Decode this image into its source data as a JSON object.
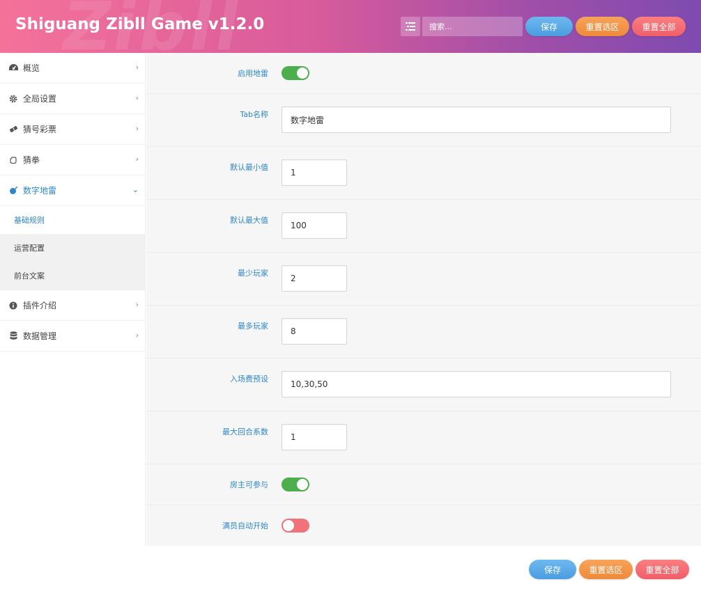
{
  "header": {
    "title": "Shiguang Zibll Game v1.2.0",
    "search_placeholder": "搜索...",
    "save_label": "保存",
    "reset_section_label": "重置选区",
    "reset_all_label": "重置全部"
  },
  "sidebar": {
    "items": [
      {
        "label": "概览",
        "icon": "dashboard-icon"
      },
      {
        "label": "全局设置",
        "icon": "gear-icon"
      },
      {
        "label": "猜号彩票",
        "icon": "ticket-icon"
      },
      {
        "label": "猜拳",
        "icon": "hand-icon"
      },
      {
        "label": "数字地雷",
        "icon": "bomb-icon",
        "active": true
      },
      {
        "label": "插件介绍",
        "icon": "info-icon"
      },
      {
        "label": "数据管理",
        "icon": "database-icon"
      }
    ],
    "subitems": [
      {
        "label": "基础规则",
        "active": true
      },
      {
        "label": "运营配置"
      },
      {
        "label": "前台文案"
      }
    ]
  },
  "form": {
    "enable_mines_label": "启用地雷",
    "enable_mines_on": true,
    "tab_name_label": "Tab名称",
    "tab_name_value": "数字地雷",
    "default_min_label": "默认最小值",
    "default_min_value": "1",
    "default_max_label": "默认最大值",
    "default_max_value": "100",
    "min_players_label": "最少玩家",
    "min_players_value": "2",
    "max_players_label": "最多玩家",
    "max_players_value": "8",
    "entry_fee_label": "入场费预设",
    "entry_fee_value": "10,30,50",
    "max_round_factor_label": "最大回合系数",
    "max_round_factor_value": "1",
    "host_join_label": "房主可参与",
    "host_join_on": true,
    "auto_start_label": "满员自动开始",
    "auto_start_on": false
  },
  "footer": {
    "save_label": "保存",
    "reset_section_label": "重置选区",
    "reset_all_label": "重置全部"
  },
  "colors": {
    "accent": "#2f87c9",
    "toggle_on": "#4cae4c",
    "toggle_off": "#f0727a",
    "save": "#4a9de0",
    "reset_section": "#ee8a3a",
    "reset_all": "#f05e6a"
  }
}
